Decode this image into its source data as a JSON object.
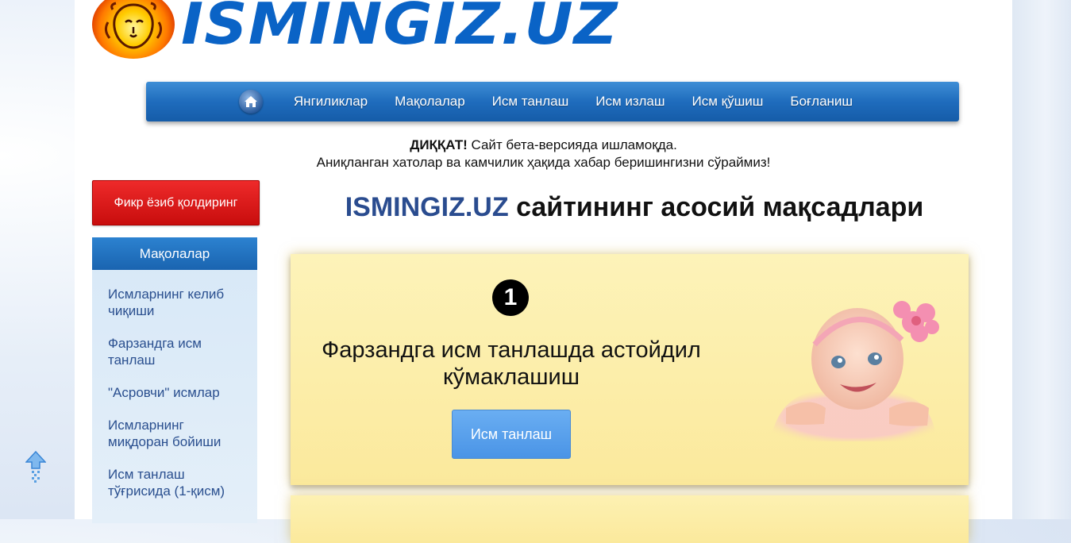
{
  "logo": {
    "text": "ISMINGIZ.UZ"
  },
  "nav": {
    "home_icon": "home-icon",
    "items": [
      "Янгиликлар",
      "Мақолалар",
      "Исм танлаш",
      "Исм излаш",
      "Исм қўшиш",
      "Боғланиш"
    ]
  },
  "notice": {
    "bold": "ДИҚҚАТ!",
    "line1": " Сайт бета-версияда ишламоқда.",
    "line2": "Аниқланган хатолар ва камчилик ҳақида хабар беришингизни сўраймиз!"
  },
  "sidebar": {
    "feedback_button": "Фикр ёзиб қолдиринг",
    "header": "Мақолалар",
    "items": [
      "Исмларнинг келиб чиқиши",
      "Фарзандга исм танлаш",
      "\"Асровчи\" исмлар",
      "Исмларнинг миқдоран бойиши",
      "Исм танлаш тўғрисида (1-қисм)"
    ]
  },
  "main": {
    "title_brand": "ISMINGIZ.UZ",
    "title_rest": " сайтининг асосий мақсадлари",
    "card1": {
      "number": "1",
      "text": "Фарзандга исм танлашда астойдил кўмаклашиш",
      "button": "Исм танлаш"
    }
  },
  "colors": {
    "brand_blue": "#0a63c6",
    "nav_blue": "#1f6cbd",
    "feedback_red": "#d81b1b",
    "card_yellow": "#fbeca6"
  }
}
